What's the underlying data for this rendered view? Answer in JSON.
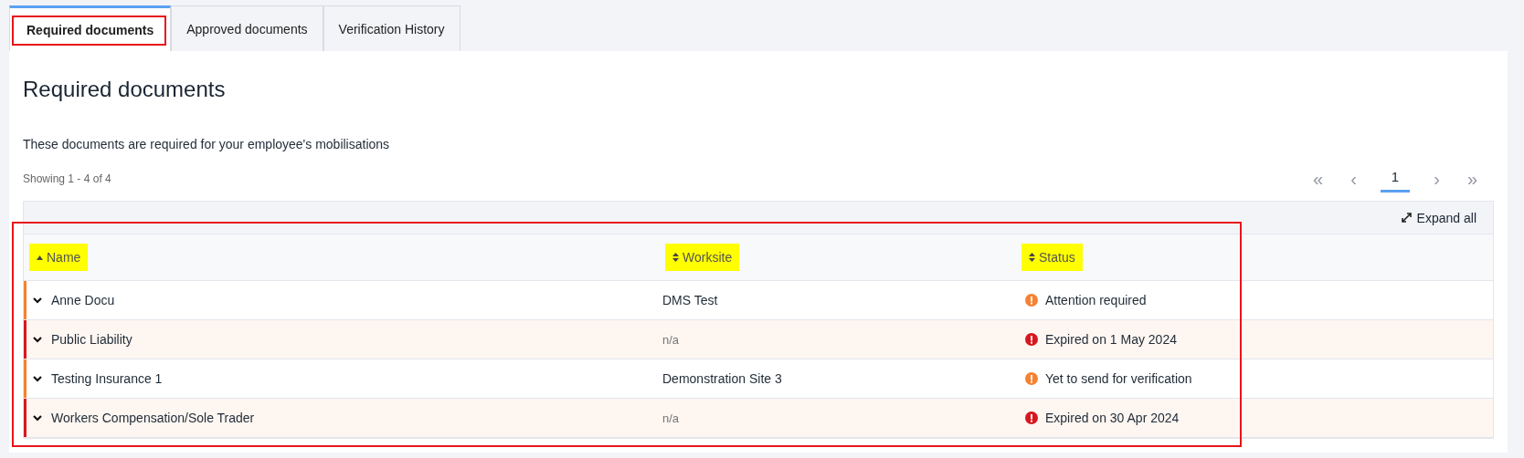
{
  "tabs": [
    {
      "label": "Required documents",
      "selected": true,
      "outlined": true
    },
    {
      "label": "Approved documents",
      "selected": false,
      "outlined": false
    },
    {
      "label": "Verification History",
      "selected": false,
      "outlined": false
    }
  ],
  "heading": "Required documents",
  "description": "These documents are required for your employee's mobilisations",
  "showing": "Showing 1 - 4 of 4",
  "pagination": {
    "first": "«",
    "prev": "‹",
    "pages": [
      {
        "label": "1",
        "selected": true
      }
    ],
    "next": "›",
    "last": "»"
  },
  "table": {
    "outlined": true,
    "expand_all": "Expand all",
    "columns": [
      {
        "label": "Name",
        "sorted_ascending": true,
        "highlighted": true
      },
      {
        "label": "Worksite",
        "sorted_ascending": false,
        "highlighted": true
      },
      {
        "label": "Status",
        "sorted_ascending": false,
        "highlighted": true
      }
    ],
    "rows": [
      {
        "name": "Anne Docu",
        "worksite": "DMS Test",
        "worksite_muted": false,
        "status": "Attention required",
        "expired": false
      },
      {
        "name": "Public Liability",
        "worksite": "n/a",
        "worksite_muted": true,
        "status": "Expired on 1 May 2024",
        "expired": true
      },
      {
        "name": "Testing Insurance 1",
        "worksite": "Demonstration Site 3",
        "worksite_muted": false,
        "status": "Yet to send for verification",
        "expired": false
      },
      {
        "name": "Workers Compensation/Sole Trader",
        "worksite": "n/a",
        "worksite_muted": true,
        "status": "Expired on 30 Apr 2024",
        "expired": true
      }
    ]
  }
}
